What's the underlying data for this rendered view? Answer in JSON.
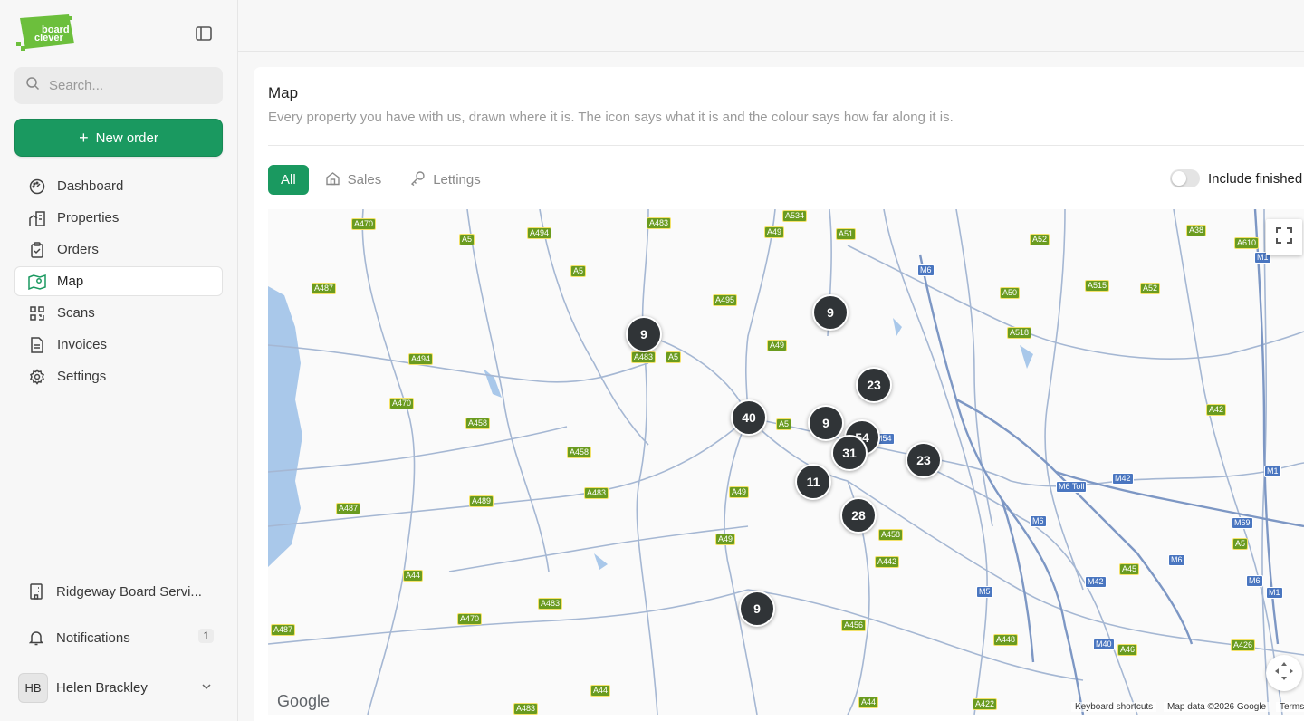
{
  "sidebar": {
    "search_placeholder": "Search...",
    "new_order_label": "New order",
    "nav": [
      {
        "label": "Dashboard",
        "icon": "dashboard-icon"
      },
      {
        "label": "Properties",
        "icon": "properties-icon"
      },
      {
        "label": "Orders",
        "icon": "orders-icon"
      },
      {
        "label": "Map",
        "icon": "map-icon",
        "active": true
      },
      {
        "label": "Scans",
        "icon": "qr-icon"
      },
      {
        "label": "Invoices",
        "icon": "invoice-icon"
      },
      {
        "label": "Settings",
        "icon": "gear-icon"
      }
    ],
    "organisation": "Ridgeway Board Servi...",
    "notifications_label": "Notifications",
    "notifications_count": "1",
    "user": {
      "initials": "HB",
      "name": "Helen Brackley"
    }
  },
  "page": {
    "title": "Map",
    "subtitle": "Every property you have with us, drawn where it is. The icon says what it is and the colour says how far along it is.",
    "tabs": [
      {
        "label": "All",
        "active": true
      },
      {
        "label": "Sales",
        "icon": "house-icon"
      },
      {
        "label": "Lettings",
        "icon": "key-icon"
      }
    ],
    "include_finished_label": "Include finished",
    "include_finished": false
  },
  "map": {
    "clusters": [
      "9",
      "9",
      "23",
      "40",
      "9",
      "54",
      "31",
      "23",
      "11",
      "28",
      "9"
    ],
    "road_labels": [
      "A470",
      "A483",
      "A534",
      "A494",
      "A5",
      "A49",
      "A51",
      "A52",
      "A38",
      "A610",
      "M1",
      "A487",
      "A5",
      "M6",
      "A495",
      "A50",
      "A515",
      "A52",
      "A518",
      "A49",
      "A494",
      "A483",
      "A5",
      "A470",
      "A458",
      "A5",
      "M54",
      "A42",
      "A458",
      "A49",
      "A483",
      "A487",
      "A489",
      "M6 Toll",
      "M42",
      "M1",
      "M6",
      "A458",
      "A49",
      "M69",
      "A5",
      "A44",
      "A442",
      "M6",
      "A483",
      "M5",
      "M42",
      "A45",
      "M1",
      "M6",
      "A470",
      "A456",
      "A487",
      "A448",
      "M40",
      "A46",
      "A426",
      "A483",
      "A44",
      "A44",
      "A422"
    ],
    "google_text": "Google",
    "keyboard_shortcuts": "Keyboard shortcuts",
    "map_data": "Map data ©2026 Google",
    "terms": "Terms"
  },
  "colors": {
    "accent": "#1a9960",
    "cluster": "#303437",
    "water": "#a9c8ea",
    "road": "#9fb3d1"
  }
}
